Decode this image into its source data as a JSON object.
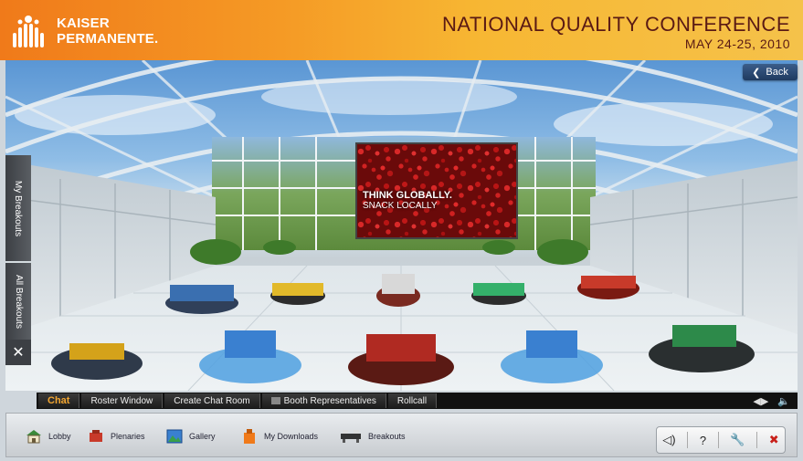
{
  "header": {
    "logo_line1": "KAISER",
    "logo_line2": "PERMANENTE.",
    "conference_title": "NATIONAL QUALITY CONFERENCE",
    "conference_dates": "MAY 24-25, 2010"
  },
  "scene": {
    "back_label": "Back",
    "screen_line1": "THINK GLOBALLY.",
    "screen_line2": "SNACK LOCALLY"
  },
  "side_tabs": {
    "my_breakouts": "My Breakouts",
    "all_breakouts": "All Breakouts",
    "close": "✕"
  },
  "chat_bar": {
    "tabs": [
      "Chat",
      "Roster Window",
      "Create Chat Room",
      "Booth Representatives",
      "Rollcall"
    ]
  },
  "bottom_nav": {
    "items": [
      {
        "label": "Lobby",
        "icon": "lobby-icon"
      },
      {
        "label": "Plenaries",
        "icon": "plenaries-icon"
      },
      {
        "label": "Gallery",
        "icon": "gallery-icon"
      },
      {
        "label": "My Downloads",
        "icon": "downloads-icon"
      },
      {
        "label": "Breakouts",
        "icon": "breakouts-icon"
      }
    ],
    "system": {
      "help": "?"
    }
  },
  "colors": {
    "header_orange": "#f07a1a",
    "header_yellow": "#f5c24a",
    "title_brown": "#5a1a14",
    "chat_active": "#f2a530"
  }
}
